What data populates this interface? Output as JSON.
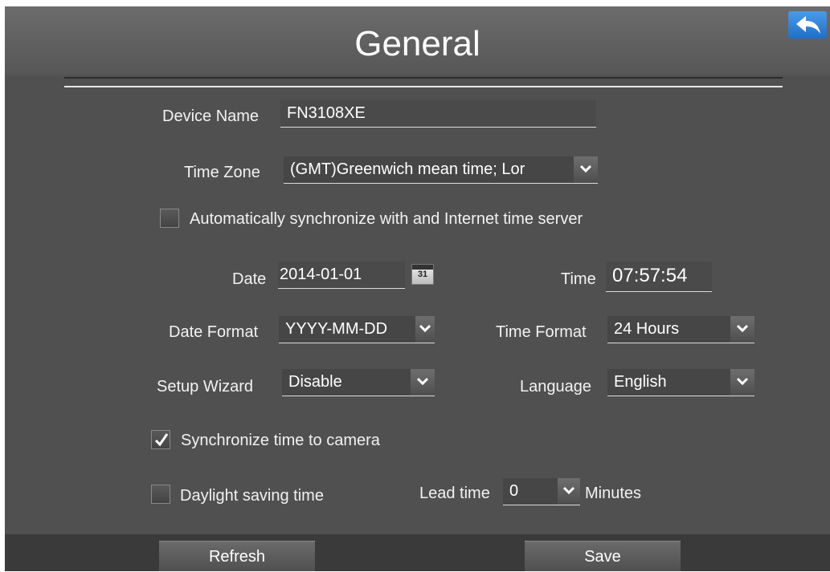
{
  "header": {
    "title": "General"
  },
  "fields": {
    "device_name_label": "Device Name",
    "device_name_value": "FN3108XE",
    "time_zone_label": "Time Zone",
    "time_zone_value": "(GMT)Greenwich mean time; Lor",
    "auto_sync_label": "Automatically synchronize with and Internet time server",
    "auto_sync_checked": false,
    "date_label": "Date",
    "date_value": "2014-01-01",
    "calendar_day": "31",
    "time_label": "Time",
    "time_value": "07:57:54",
    "date_format_label": "Date Format",
    "date_format_value": "YYYY-MM-DD",
    "time_format_label": "Time Format",
    "time_format_value": "24 Hours",
    "setup_wizard_label": "Setup Wizard",
    "setup_wizard_value": "Disable",
    "language_label": "Language",
    "language_value": "English",
    "sync_camera_label": "Synchronize time to camera",
    "sync_camera_checked": true,
    "dst_label": "Daylight saving time",
    "dst_checked": false,
    "lead_time_label": "Lead time",
    "lead_time_value": "0",
    "minutes_label": "Minutes"
  },
  "footer": {
    "refresh_label": "Refresh",
    "save_label": "Save"
  },
  "icons": {
    "back": "back-arrow-icon",
    "dropdown": "chevron-down-icon",
    "calendar": "calendar-icon",
    "check": "checkmark-icon"
  },
  "colors": {
    "background": "#505050",
    "back_button": "#2a7bd6"
  }
}
